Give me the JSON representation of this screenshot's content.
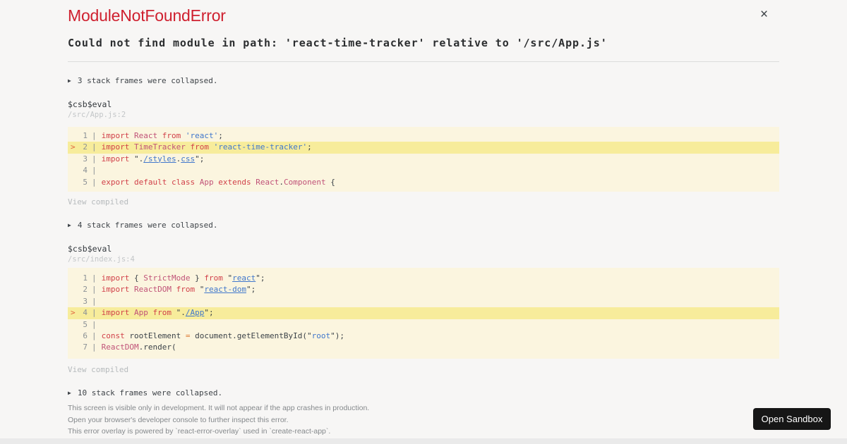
{
  "colors": {
    "page_bg": "#f7f6f5",
    "code_bg": "#fbf5df",
    "highlight_bg": "#f7ec9b",
    "title_red": "#cf202f",
    "keyword_red": "#d14049",
    "definition_pink": "#c05278",
    "string_blue": "#4077cc",
    "plain_dark": "#3b4248",
    "operator_orange": "#dd7a33",
    "button_bg": "#161616",
    "button_text": "#ffffff"
  },
  "header": {
    "title": "ModuleNotFoundError",
    "close_glyph": "×",
    "message": "Could not find module in path: 'react-time-tracker' relative to '/src/App.js'"
  },
  "frames": [
    {
      "triangle": "▶",
      "collapsed_note": "3 stack frames were collapsed.",
      "fn": "$csb$eval",
      "location": "/src/App.js:2",
      "view_compiled": "View compiled",
      "code": {
        "lines": [
          {
            "n": "1",
            "highlight": false,
            "tokens": [
              [
                "kw",
                "import"
              ],
              [
                "p",
                " "
              ],
              [
                "def",
                "React"
              ],
              [
                "p",
                " "
              ],
              [
                "kw",
                "from"
              ],
              [
                "p",
                " "
              ],
              [
                "str",
                "'react'"
              ],
              [
                "p",
                ";"
              ]
            ]
          },
          {
            "n": "2",
            "highlight": true,
            "tokens": [
              [
                "kw",
                "import"
              ],
              [
                "p",
                " "
              ],
              [
                "def",
                "TimeTracker"
              ],
              [
                "p",
                " "
              ],
              [
                "kw",
                "from"
              ],
              [
                "p",
                " "
              ],
              [
                "str",
                "'react-time-tracker'"
              ],
              [
                "p",
                ";"
              ]
            ]
          },
          {
            "n": "3",
            "highlight": false,
            "tokens": [
              [
                "kw",
                "import"
              ],
              [
                "p",
                " \"."
              ],
              [
                "strU",
                "/styles"
              ],
              [
                "p",
                "."
              ],
              [
                "strU",
                "css"
              ],
              [
                "p",
                "\";"
              ]
            ]
          },
          {
            "n": "4",
            "highlight": false,
            "tokens": []
          },
          {
            "n": "5",
            "highlight": false,
            "tokens": [
              [
                "kw",
                "export"
              ],
              [
                "p",
                " "
              ],
              [
                "kw",
                "default"
              ],
              [
                "p",
                " "
              ],
              [
                "kw",
                "class"
              ],
              [
                "p",
                " "
              ],
              [
                "def",
                "App"
              ],
              [
                "p",
                " "
              ],
              [
                "kw",
                "extends"
              ],
              [
                "p",
                " "
              ],
              [
                "def",
                "React"
              ],
              [
                "p",
                "."
              ],
              [
                "def",
                "Component"
              ],
              [
                "p",
                " {"
              ]
            ]
          }
        ]
      }
    },
    {
      "triangle": "▶",
      "collapsed_note": "4 stack frames were collapsed.",
      "fn": "$csb$eval",
      "location": "/src/index.js:4",
      "view_compiled": "View compiled",
      "code": {
        "lines": [
          {
            "n": "1",
            "highlight": false,
            "tokens": [
              [
                "kw",
                "import"
              ],
              [
                "p",
                " { "
              ],
              [
                "def",
                "StrictMode"
              ],
              [
                "p",
                " } "
              ],
              [
                "kw",
                "from"
              ],
              [
                "p",
                " \""
              ],
              [
                "strU",
                "react"
              ],
              [
                "p",
                "\";"
              ]
            ]
          },
          {
            "n": "2",
            "highlight": false,
            "tokens": [
              [
                "kw",
                "import"
              ],
              [
                "p",
                " "
              ],
              [
                "def",
                "ReactDOM"
              ],
              [
                "p",
                " "
              ],
              [
                "kw",
                "from"
              ],
              [
                "p",
                " \""
              ],
              [
                "strU",
                "react-dom"
              ],
              [
                "p",
                "\";"
              ]
            ]
          },
          {
            "n": "3",
            "highlight": false,
            "tokens": []
          },
          {
            "n": "4",
            "highlight": true,
            "tokens": [
              [
                "kw",
                "import"
              ],
              [
                "p",
                " "
              ],
              [
                "def",
                "App"
              ],
              [
                "p",
                " "
              ],
              [
                "kw",
                "from"
              ],
              [
                "p",
                " \"."
              ],
              [
                "strU",
                "/App"
              ],
              [
                "p",
                "\";"
              ]
            ]
          },
          {
            "n": "5",
            "highlight": false,
            "tokens": []
          },
          {
            "n": "6",
            "highlight": false,
            "tokens": [
              [
                "kw",
                "const"
              ],
              [
                "p",
                " rootElement "
              ],
              [
                "op",
                "="
              ],
              [
                "p",
                " document.getElementById(\""
              ],
              [
                "str",
                "root"
              ],
              [
                "p",
                "\");"
              ]
            ]
          },
          {
            "n": "7",
            "highlight": false,
            "tokens": [
              [
                "def",
                "ReactDOM"
              ],
              [
                "p",
                ".render("
              ]
            ]
          }
        ]
      }
    }
  ],
  "bottom": {
    "triangle": "▶",
    "collapsed_note": "10 stack frames were collapsed.",
    "notes": [
      "This screen is visible only in development. It will not appear if the app crashes in production.",
      "Open your browser's developer console to further inspect this error.",
      "This error overlay is powered by `react-error-overlay` used in `create-react-app`."
    ],
    "open_sandbox_label": "Open Sandbox"
  }
}
